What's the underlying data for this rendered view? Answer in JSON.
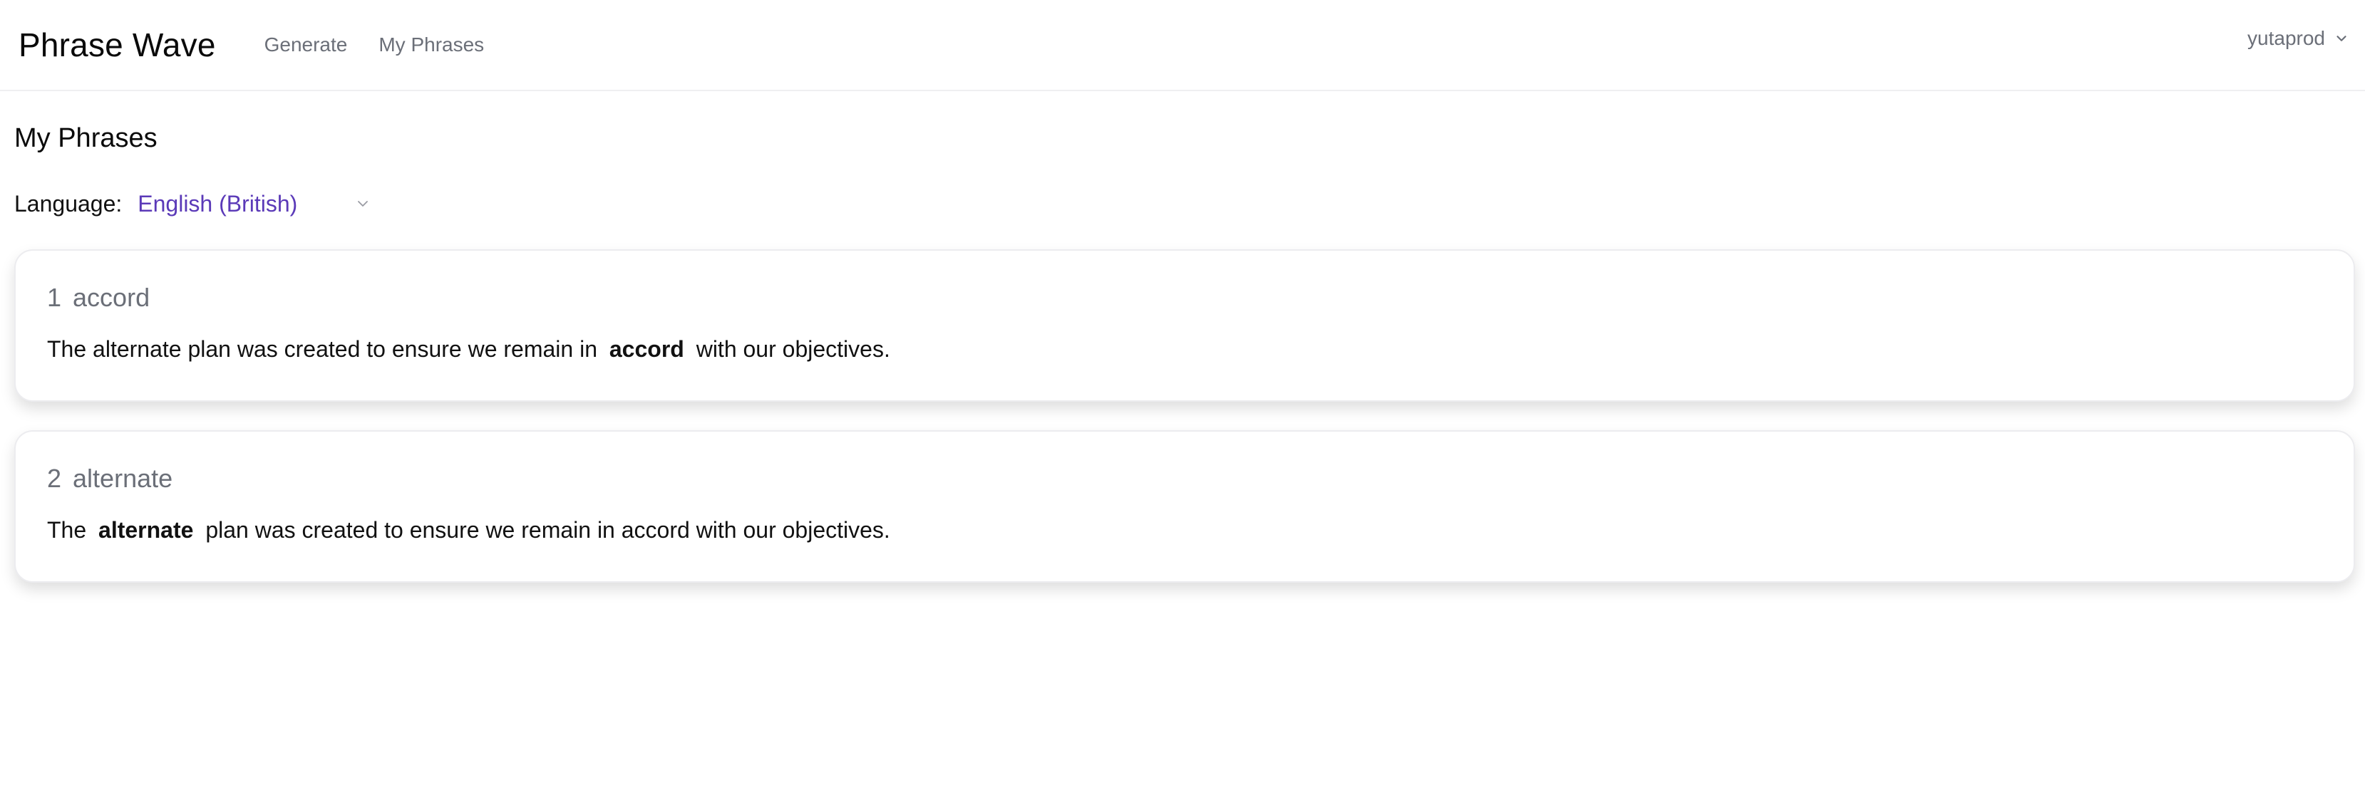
{
  "app": {
    "title": "Phrase Wave"
  },
  "nav": {
    "items": [
      {
        "label": "Generate"
      },
      {
        "label": "My Phrases"
      }
    ]
  },
  "user": {
    "name": "yutaprod"
  },
  "page": {
    "title": "My Phrases"
  },
  "language": {
    "label": "Language:",
    "selected": "English (British)"
  },
  "colors": {
    "accent": "#5b3ab8",
    "muted": "#6b6f78",
    "text": "#111111"
  },
  "phrases": [
    {
      "index": "1",
      "word": "accord",
      "before": "The alternate plan was created to ensure we remain in",
      "highlight": "accord",
      "after": "with our objectives."
    },
    {
      "index": "2",
      "word": "alternate",
      "before": "The",
      "highlight": "alternate",
      "after": "plan was created to ensure we remain in accord with our objectives."
    }
  ]
}
